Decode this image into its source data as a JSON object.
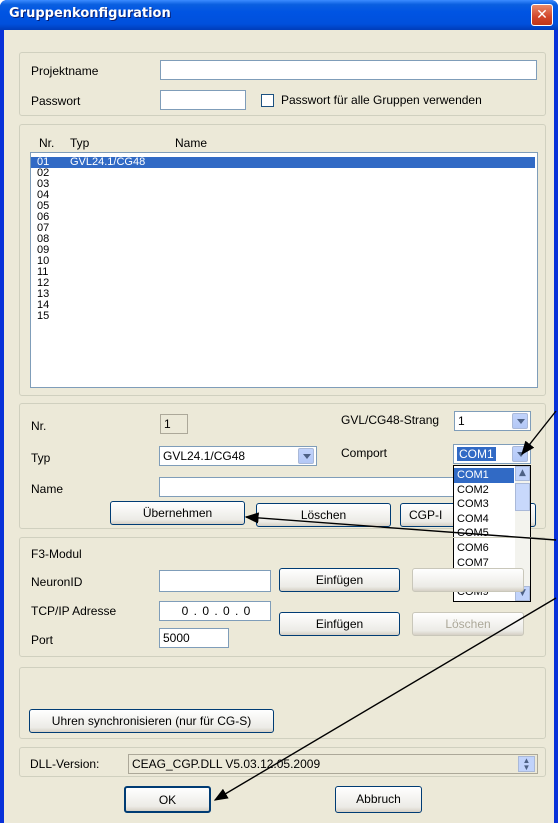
{
  "window": {
    "title": "Gruppenkonfiguration",
    "close_glyph": "✕"
  },
  "project": {
    "name_label": "Projektname",
    "name_value": "",
    "password_label": "Passwort",
    "password_value": "",
    "use_password_all_label": "Passwort für alle Gruppen verwenden",
    "use_password_all_checked": false
  },
  "group_list": {
    "columns": [
      "Nr.",
      "Typ",
      "Name"
    ],
    "rows": [
      {
        "nr": "01",
        "typ": "GVL24.1/CG48",
        "name": ""
      },
      {
        "nr": "02",
        "typ": "",
        "name": ""
      },
      {
        "nr": "03",
        "typ": "",
        "name": ""
      },
      {
        "nr": "04",
        "typ": "",
        "name": ""
      },
      {
        "nr": "05",
        "typ": "",
        "name": ""
      },
      {
        "nr": "06",
        "typ": "",
        "name": ""
      },
      {
        "nr": "07",
        "typ": "",
        "name": ""
      },
      {
        "nr": "08",
        "typ": "",
        "name": ""
      },
      {
        "nr": "09",
        "typ": "",
        "name": ""
      },
      {
        "nr": "10",
        "typ": "",
        "name": ""
      },
      {
        "nr": "11",
        "typ": "",
        "name": ""
      },
      {
        "nr": "12",
        "typ": "",
        "name": ""
      },
      {
        "nr": "13",
        "typ": "",
        "name": ""
      },
      {
        "nr": "14",
        "typ": "",
        "name": ""
      },
      {
        "nr": "15",
        "typ": "",
        "name": ""
      }
    ],
    "selected_index": 0
  },
  "details": {
    "nr_label": "Nr.",
    "nr_value": "1",
    "strang_label": "GVL/CG48-Strang",
    "strang_value": "1",
    "typ_label": "Typ",
    "typ_value": "GVL24.1/CG48",
    "comport_label": "Comport",
    "comport_value": "COM1",
    "comport_options": [
      "COM1",
      "COM2",
      "COM3",
      "COM4",
      "COM5",
      "COM6",
      "COM7",
      "COM8",
      "COM9"
    ],
    "name_label": "Name",
    "name_value": "",
    "apply_button": "Übernehmen",
    "delete_button": "Löschen",
    "cgp_button": "CGP-I"
  },
  "f3": {
    "section_label": "F3-Modul",
    "neuron_label": "NeuronID",
    "neuron_value": "",
    "neuron_insert": "Einfügen",
    "ip_label": "TCP/IP Adresse",
    "ip_value": "0 . 0 . 0 . 0",
    "port_label": "Port",
    "port_value": "5000",
    "ip_insert": "Einfügen",
    "ip_delete": "Löschen"
  },
  "sync": {
    "button": "Uhren synchronisieren (nur für CG-S)"
  },
  "dll": {
    "label": "DLL-Version:",
    "value": "CEAG_CGP.DLL V5.03.12.05.2009"
  },
  "footer": {
    "ok": "OK",
    "cancel": "Abbruch"
  }
}
